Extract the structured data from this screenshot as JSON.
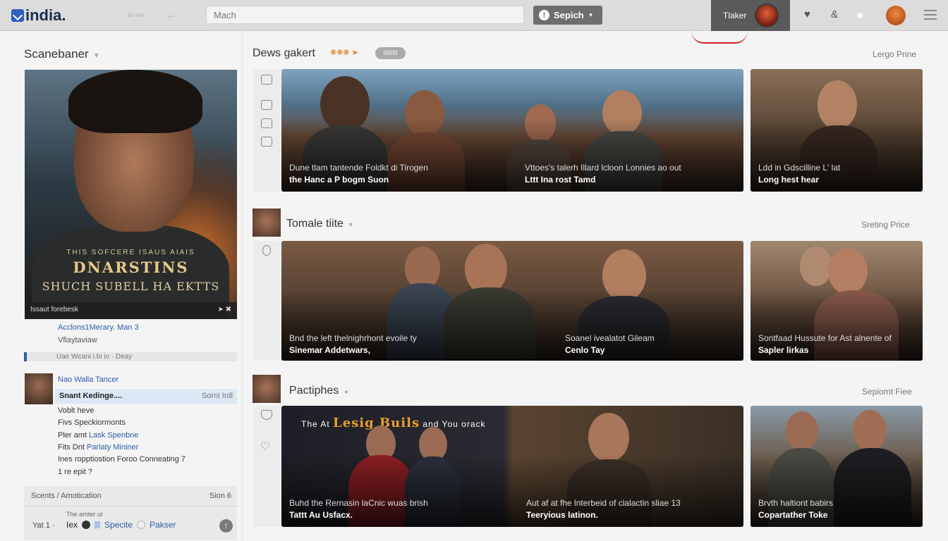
{
  "app": {
    "logo_text": "india."
  },
  "search": {
    "placeholder": "Mach",
    "button_label": "Sepich"
  },
  "header": {
    "ticker_label": "Tlaker"
  },
  "sidebar": {
    "title": "Scanebaner",
    "poster": {
      "subtitle": "THIS SOFCERE ISAUS AIAIS",
      "title_line1": "DNARSTINS",
      "title_line2": "SHUCH SUBELL HA EKTTS",
      "bar_label": "Issaut forebesk"
    },
    "meta_primary": "Acclons1Merary. Man 3",
    "meta_secondary": "Vfiaytaviaw",
    "progress_label": "Uae Wcani i.bi io · Deay",
    "now_heading": "Nao Walla Tancer",
    "highlight": {
      "label": "Snant Kedinge....",
      "right": "Sorni Irdl"
    },
    "list": [
      {
        "text": "Voblt heve",
        "link": ""
      },
      {
        "text": "Fivs Speckiormonts",
        "link": ""
      },
      {
        "text": "Pler amt",
        "link": "Lask Spenbne"
      },
      {
        "text": "Fits Dnt",
        "link": "Parlaty Mininer"
      },
      {
        "text": "Ines ropptiostion Foroo Conneating 7",
        "link": ""
      },
      {
        "text": "1 re epit ?",
        "link": ""
      }
    ],
    "bottom": {
      "head_left": "Scents / Amotication",
      "head_right": "Sion 6",
      "small_label": "The arnter ur",
      "left_label": "Yat 1 ·",
      "row_word1": "Iex",
      "row_link1": "Specite",
      "row_link2": "Pakser"
    }
  },
  "sections": [
    {
      "title": "Dews gakert",
      "right": "Lergo Prine",
      "pill": "0000",
      "cards": [
        {
          "line1": "Dune tlam tantende Foldkt di Tirogen",
          "line2": "the Hanc a P bogm Suon",
          "line3": "Vttoes's talerh Illard lcloon Lonnies ao out",
          "line4": "Lttt Ina rost Tamd"
        },
        {
          "line1": "Ldd in Gdscilline L' lat",
          "line2": "Long hest hear"
        }
      ]
    },
    {
      "title": "Tomale tiite",
      "right": "Sreting Price",
      "cards": [
        {
          "line1": "Bnd the left thelnighrhont evoile ty",
          "line2": "Sinemar Addetwars,",
          "line3": "Soanel ivealatot Gileam",
          "line4": "Cenlo Tay"
        },
        {
          "line1": "Sontfaad Hussute for Ast alnente of",
          "line2": "Sapler lirkas"
        }
      ]
    },
    {
      "title": "Pactiphes",
      "right": "Sepiomt Fiee",
      "cards": [
        {
          "hero_pre": "The At",
          "hero_big": "Lesig Buils",
          "hero_post": "and You orack",
          "line1": "Buhd the Rernasin laCnic wuas brish",
          "line2": "Tattt Au Usfacx.",
          "line3": "Aut af at fhe lnterbeid of clalactin sliae 13",
          "line4": "Teeryious latinon."
        },
        {
          "line1": "Brvth haltiont babirs",
          "line2": "Copartather Toke"
        }
      ]
    }
  ],
  "colors": {
    "accent": "#2b5ca8",
    "topbar": "#dcdcdc",
    "highlight_row": "#dde8f6",
    "fire": "#e07c1a"
  },
  "icons": [
    "logo-icon",
    "back-icon",
    "left-arrow-icon",
    "search-icon",
    "heart-icon",
    "ampersand-icon",
    "user-icon",
    "menu-icon",
    "chevron-down-icon",
    "chat-icon",
    "bookmark-icon",
    "pin-icon",
    "plus-icon"
  ]
}
